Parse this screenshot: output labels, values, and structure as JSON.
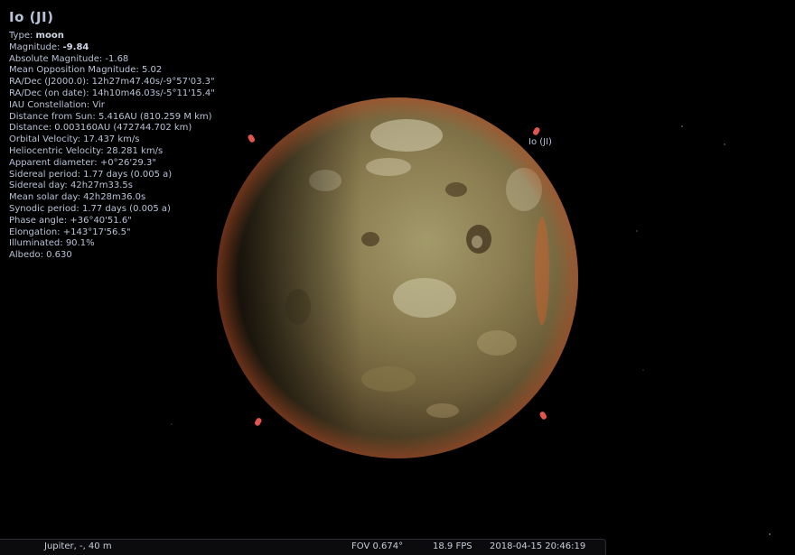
{
  "object": {
    "title": "Io (JI)",
    "label": "Io (JI)"
  },
  "info_rows": [
    {
      "label": "Type: ",
      "value": "moon",
      "bold": true
    },
    {
      "label": "Magnitude: ",
      "value": "-9.84",
      "bold": true
    },
    {
      "label": "Absolute Magnitude: ",
      "value": "-1.68"
    },
    {
      "label": "Mean Opposition Magnitude: ",
      "value": "5.02"
    },
    {
      "label": "RA/Dec (J2000.0): ",
      "value": "12h27m47.40s/-9°57'03.3\""
    },
    {
      "label": "RA/Dec (on date): ",
      "value": "14h10m46.03s/-5°11'15.4\""
    },
    {
      "label": "IAU Constellation: ",
      "value": "Vir"
    },
    {
      "label": "Distance from Sun: ",
      "value": "5.416AU (810.259 M km)"
    },
    {
      "label": "Distance: ",
      "value": "0.003160AU (472744.702 km)"
    },
    {
      "label": "Orbital Velocity: ",
      "value": "17.437 km/s"
    },
    {
      "label": "Heliocentric Velocity: ",
      "value": "28.281 km/s"
    },
    {
      "label": "Apparent diameter: ",
      "value": "+0°26'29.3\""
    },
    {
      "label": "Sidereal period: ",
      "value": "1.77 days (0.005 a)"
    },
    {
      "label": "Sidereal day: ",
      "value": "42h27m33.5s"
    },
    {
      "label": "Mean solar day: ",
      "value": "42h28m36.0s"
    },
    {
      "label": "Synodic period: ",
      "value": "1.77 days (0.005 a)"
    },
    {
      "label": "Phase angle: ",
      "value": "+36°40'51.6\""
    },
    {
      "label": "Elongation: ",
      "value": "+143°17'56.5\""
    },
    {
      "label": "Illuminated: ",
      "value": "90.1%"
    },
    {
      "label": "Albedo: ",
      "value": "0.630"
    }
  ],
  "status": {
    "location": "Jupiter, -, 40 m",
    "fov": "FOV 0.674°",
    "fps": "18.9 FPS",
    "datetime": "2018-04-15 20:46:19"
  },
  "colors": {
    "marker": "#e0564f",
    "text": "#b9c2d6",
    "sky": "#000000"
  }
}
